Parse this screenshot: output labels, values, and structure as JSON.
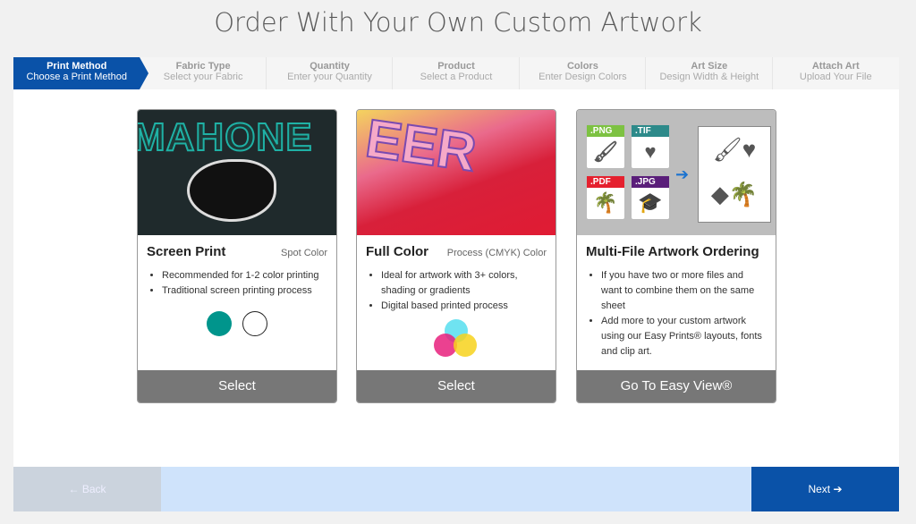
{
  "title": "Order With Your Own Custom Artwork",
  "steps": [
    {
      "title": "Print Method",
      "sub": "Choose a Print Method"
    },
    {
      "title": "Fabric Type",
      "sub": "Select your Fabric"
    },
    {
      "title": "Quantity",
      "sub": "Enter your Quantity"
    },
    {
      "title": "Product",
      "sub": "Select a Product"
    },
    {
      "title": "Colors",
      "sub": "Enter Design Colors"
    },
    {
      "title": "Art Size",
      "sub": "Design Width & Height"
    },
    {
      "title": "Attach Art",
      "sub": "Upload Your File"
    }
  ],
  "cards": [
    {
      "name": "Screen Print",
      "subtitle": "Spot Color",
      "bullets": [
        "Recommended for 1-2 color printing",
        "Traditional screen printing process"
      ],
      "button": "Select",
      "image_text": "MAHONE",
      "colors": [
        "#00958c",
        "#ffffff"
      ]
    },
    {
      "name": "Full Color",
      "subtitle": "Process (CMYK) Color",
      "bullets": [
        "Ideal for artwork with 3+ colors, shading or gradients",
        "Digital based printed process"
      ],
      "button": "Select",
      "image_text": "EER"
    },
    {
      "name": "Multi-File Artwork Ordering",
      "subtitle": "",
      "bullets": [
        "If you have two or more files and want to combine them on the same sheet",
        "Add more to your custom artwork using our Easy Prints® layouts, fonts and clip art."
      ],
      "button": "Go To Easy View®",
      "files": [
        ".PNG",
        ".TIF",
        ".PDF",
        ".JPG"
      ]
    }
  ],
  "footer": {
    "back": "← Back",
    "next": "Next ➔"
  },
  "colors": {
    "accent": "#0a52a8",
    "button": "#777777"
  }
}
